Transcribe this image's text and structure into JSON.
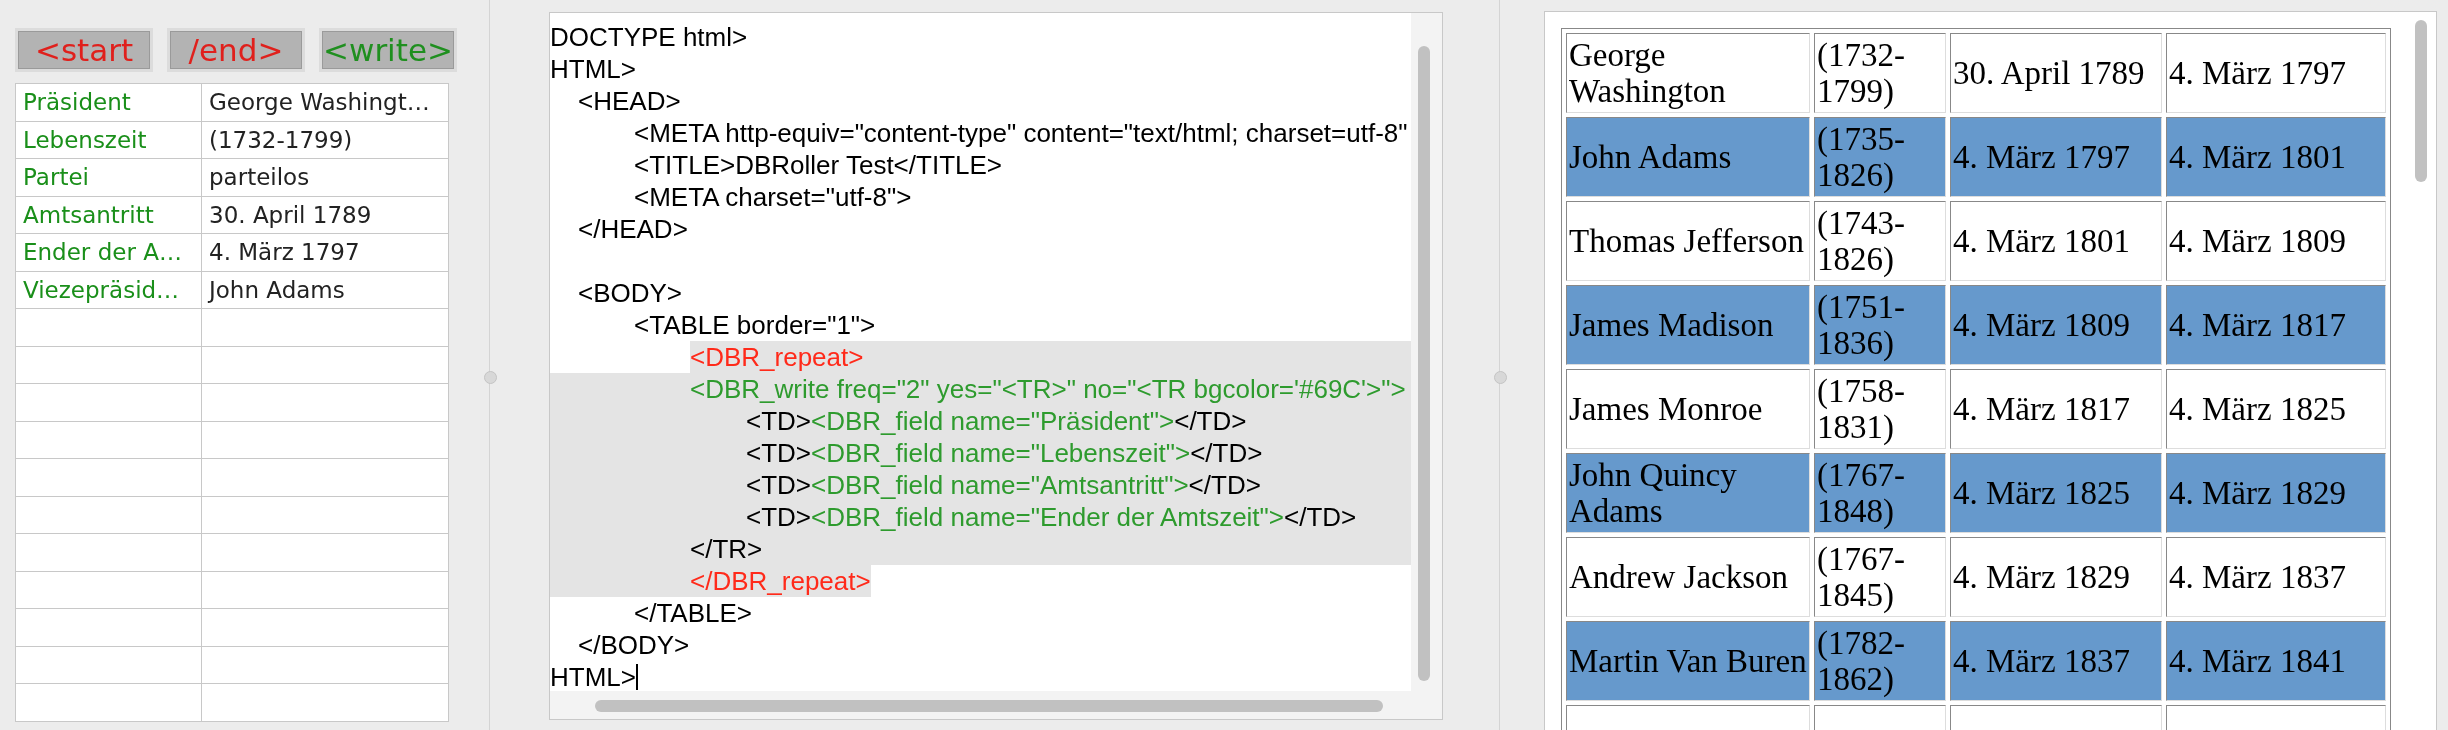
{
  "toolbar": {
    "buttons": [
      {
        "label": "<start",
        "color": "#e0201c"
      },
      {
        "label": "/end>",
        "color": "#e0201c"
      },
      {
        "label": "<write>",
        "color": "#1f8f1f"
      }
    ]
  },
  "field_table": {
    "rows": [
      {
        "label": "Präsident",
        "value": "George Washingt…"
      },
      {
        "label": "Lebenszeit",
        "value": "(1732-1799)"
      },
      {
        "label": "Partei",
        "value": "parteilos"
      },
      {
        "label": "Amtsantritt",
        "value": "30. April 1789"
      },
      {
        "label": "Ender der A…",
        "value": "4. März 1797"
      },
      {
        "label": "Viezepräsid…",
        "value": "John Adams"
      }
    ]
  },
  "editor": {
    "lines": [
      {
        "kind": "code",
        "selected": false,
        "segments": [
          {
            "kind": "html",
            "text": "DOCTYPE html>"
          }
        ]
      },
      {
        "kind": "code",
        "selected": false,
        "segments": [
          {
            "kind": "html",
            "text": "HTML>"
          }
        ]
      },
      {
        "kind": "code",
        "selected": false,
        "segments": [
          {
            "kind": "html",
            "text": "\t<HEAD>"
          }
        ]
      },
      {
        "kind": "code",
        "selected": false,
        "segments": [
          {
            "kind": "html",
            "text": "\t\t<META http-equiv=\"content-type\" content=\"text/html; charset=utf-8\""
          }
        ]
      },
      {
        "kind": "code",
        "selected": false,
        "segments": [
          {
            "kind": "html",
            "text": "\t\t<TITLE>DBRoller Test</TITLE>"
          }
        ]
      },
      {
        "kind": "code",
        "selected": false,
        "segments": [
          {
            "kind": "html",
            "text": "\t\t<META charset=\"utf-8\">"
          }
        ]
      },
      {
        "kind": "code",
        "selected": false,
        "segments": [
          {
            "kind": "html",
            "text": "\t</HEAD>"
          }
        ]
      },
      {
        "kind": "blank"
      },
      {
        "kind": "code",
        "selected": false,
        "segments": [
          {
            "kind": "html",
            "text": "\t<BODY>"
          }
        ]
      },
      {
        "kind": "code",
        "selected": false,
        "segments": [
          {
            "kind": "html",
            "text": "\t\t<TABLE border=\"1\">"
          }
        ]
      },
      {
        "kind": "code",
        "selected": true,
        "segments": [
          {
            "kind": "repeat",
            "text": "\t\t\t<DBR_repeat>"
          }
        ]
      },
      {
        "kind": "code",
        "selected": true,
        "segments": [
          {
            "kind": "dbr",
            "text": "\t\t\t<DBR_write freq=\"2\" yes=\"<TR>\" no=\"<TR bgcolor='#69C'>\">"
          }
        ]
      },
      {
        "kind": "code",
        "selected": true,
        "segments": [
          {
            "kind": "html",
            "text": "\t\t\t\t<TD>"
          },
          {
            "kind": "dbr",
            "text": "<DBR_field name=\"Präsident\">"
          },
          {
            "kind": "html",
            "text": "</TD>"
          }
        ]
      },
      {
        "kind": "code",
        "selected": true,
        "segments": [
          {
            "kind": "html",
            "text": "\t\t\t\t<TD>"
          },
          {
            "kind": "dbr",
            "text": "<DBR_field name=\"Lebenszeit\">"
          },
          {
            "kind": "html",
            "text": "</TD>"
          }
        ]
      },
      {
        "kind": "code",
        "selected": true,
        "segments": [
          {
            "kind": "html",
            "text": "\t\t\t\t<TD>"
          },
          {
            "kind": "dbr",
            "text": "<DBR_field name=\"Amtsantritt\">"
          },
          {
            "kind": "html",
            "text": "</TD>"
          }
        ]
      },
      {
        "kind": "code",
        "selected": true,
        "segments": [
          {
            "kind": "html",
            "text": "\t\t\t\t<TD>"
          },
          {
            "kind": "dbr",
            "text": "<DBR_field name=\"Ender der Amtszeit\">"
          },
          {
            "kind": "html",
            "text": "</TD>"
          }
        ]
      },
      {
        "kind": "code",
        "selected": true,
        "segments": [
          {
            "kind": "html",
            "text": "\t\t\t</TR>"
          }
        ]
      },
      {
        "kind": "code",
        "selected": true,
        "segments": [
          {
            "kind": "repeat",
            "text": "\t\t\t</DBR_repeat>"
          }
        ]
      },
      {
        "kind": "code",
        "selected": false,
        "segments": [
          {
            "kind": "html",
            "text": "\t\t</TABLE>"
          }
        ]
      },
      {
        "kind": "code",
        "selected": false,
        "segments": [
          {
            "kind": "html",
            "text": "\t</BODY>"
          }
        ]
      },
      {
        "kind": "code",
        "selected": false,
        "cursor": true,
        "segments": [
          {
            "kind": "html",
            "text": "HTML>"
          }
        ]
      }
    ]
  },
  "preview_table": {
    "rows": [
      {
        "shaded": false,
        "cells": [
          "George Washington",
          "(1732-1799)",
          "30. April 1789",
          "4. März 1797"
        ]
      },
      {
        "shaded": true,
        "cells": [
          "John Adams",
          "(1735-1826)",
          "4. März 1797",
          "4. März 1801"
        ]
      },
      {
        "shaded": false,
        "cells": [
          "Thomas Jefferson",
          "(1743-1826)",
          "4. März 1801",
          "4. März 1809"
        ]
      },
      {
        "shaded": true,
        "cells": [
          "James Madison",
          "(1751-1836)",
          "4. März 1809",
          "4. März 1817"
        ]
      },
      {
        "shaded": false,
        "cells": [
          "James Monroe",
          "(1758-1831)",
          "4. März 1817",
          "4. März 1825"
        ]
      },
      {
        "shaded": true,
        "cells": [
          "John Quincy Adams",
          "(1767-1848)",
          "4. März 1825",
          "4. März 1829"
        ]
      },
      {
        "shaded": false,
        "cells": [
          "Andrew Jackson",
          "(1767-1845)",
          "4. März 1829",
          "4. März 1837"
        ]
      },
      {
        "shaded": true,
        "cells": [
          "Martin Van Buren",
          "(1782-1862)",
          "4. März 1837",
          "4. März 1841"
        ]
      }
    ]
  }
}
